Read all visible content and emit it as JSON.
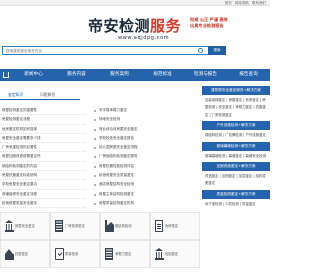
{
  "topbar": {
    "links": [
      "首页",
      "网站导航",
      "联系我们"
    ]
  },
  "logo": {
    "main": "帝安检测",
    "accent": "服务",
    "url": "www.aqjdpg.com"
  },
  "slogan": [
    "权威 公正 严谨 高效",
    "出具专业检测报告"
  ],
  "search": {
    "placeholder": "搜索建筑鉴定相关内容",
    "button": "搜索"
  },
  "nav": [
    "新闻中心",
    "服务内容",
    "服务案例",
    "规范标准",
    "检测与报告",
    "报告查询"
  ],
  "left_tabs": {
    "active": "鉴定知识",
    "other": "问题解答"
  },
  "left_list": [
    "房屋检测鉴定的重要性",
    "房屋检测鉴定流程",
    "危房鉴定机构如何选择",
    "房屋安全鉴定需要多少钱",
    "厂房承重检测的必要性",
    "房屋加固改造前需鉴定吗",
    "钢结构检测鉴定的内容",
    "房屋抗震鉴定标准说明",
    "学校房屋安全鉴定要点",
    "商铺装修安全鉴定流程",
    "民宿房屋质量安全鉴定",
    "酒店消防安全鉴定报告"
  ],
  "mid_list": [
    "写字楼承载力鉴定",
    "场地安全检测",
    "商业综合体房屋安全鉴定",
    "学校校舍安全鉴定报告",
    "幼儿园房屋安全鉴定流程",
    "厂房钢结构检测鉴定服务",
    "房屋抗震性能检测评估",
    "民宿房屋安全质量鉴定",
    "酒店房屋结构安全检测",
    "房屋主体结构检测鉴定",
    "房屋质量检测鉴定机构",
    "危房鉴定机构资质查询"
  ],
  "right_blocks": [
    {
      "title": "建筑物安全鉴定服务+解决方案",
      "body": "加装电梯鉴定 | 房屋鉴定 | 危房鉴定 | 房屋检测 | 安全鉴定 | 承载力鉴定 | 抗震鉴定 | 厂房检测鉴定"
    },
    {
      "title": "户外设施检测+解决方案",
      "body": "钢结构检测 | 广告牌检测 | 户外设施鉴定"
    },
    {
      "title": "玻璃幕墙检测+解决方案",
      "body": "玻璃幕墙检测 | 幕墙鉴定 | 幕墙安全检测"
    },
    {
      "title": "加固改造鉴定+解决方案",
      "body": "改造鉴定 | 加固鉴定 | 加层鉴定 | 结构变更鉴定"
    },
    {
      "title": "质量检测鉴定+解决方案",
      "body": "地下室检测 | 人防检测 | 质量鉴定"
    }
  ],
  "service_icons": [
    {
      "icon": "bank-icon",
      "label": "房屋安全鉴定"
    },
    {
      "icon": "building-icon",
      "label": "厂房检测鉴定"
    },
    {
      "icon": "factory-icon",
      "label": "钢结构检测"
    },
    {
      "icon": "document-icon",
      "label": "危房鉴定"
    },
    {
      "icon": "house-icon",
      "label": "抗震鉴定"
    },
    {
      "icon": "checklist-icon",
      "label": "质量检测"
    },
    {
      "icon": "building-icon",
      "label": "承载力鉴定"
    },
    {
      "icon": "bank-icon",
      "label": "加固鉴定"
    }
  ],
  "colors": {
    "primary": "#2563ad",
    "accent": "#d93b2b",
    "dark": "#1b2a38"
  }
}
